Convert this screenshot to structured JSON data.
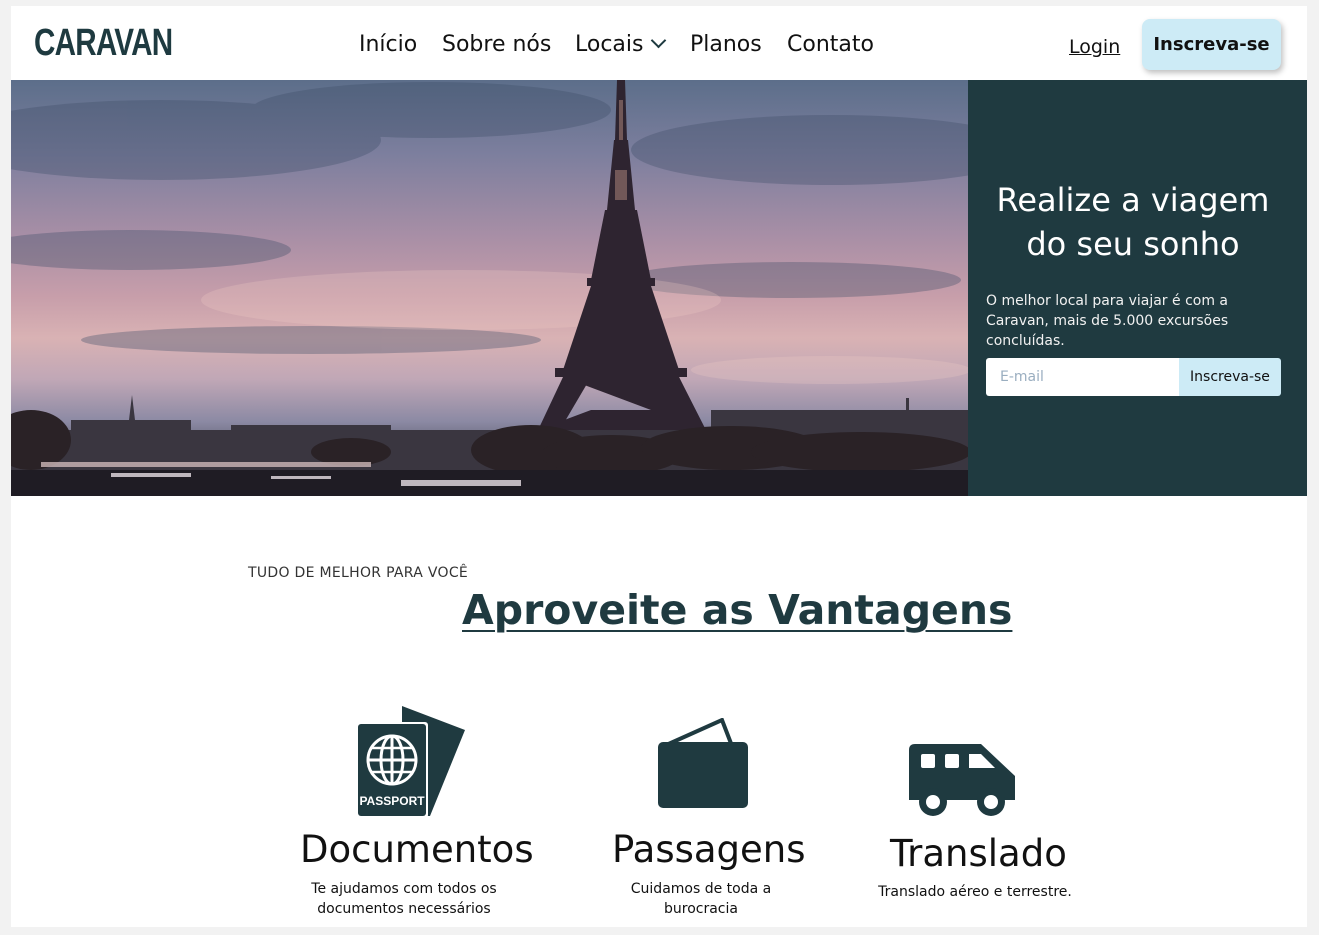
{
  "brand": {
    "logo": "CARAVAN",
    "accent": "#1f3a40",
    "cta_color": "#cdebf6"
  },
  "nav": {
    "items": [
      {
        "label": "Início"
      },
      {
        "label": "Sobre nós"
      },
      {
        "label": "Locais"
      },
      {
        "label": "Planos"
      },
      {
        "label": "Contato"
      }
    ],
    "login": "Login",
    "cta": "Inscreva-se"
  },
  "hero": {
    "title_line1": "Realize a viagem",
    "title_line2": "do seu sonho",
    "text": "O melhor local para viajar é com a Caravan, mais de 5.000 excursões concluídas.",
    "email_placeholder": "E-mail",
    "button": "Inscreva-se",
    "image": "eiffel-tower-sunset-photo"
  },
  "advantages": {
    "eyebrow": "TUDO DE MELHOR PARA VOCÊ",
    "title": "Aproveite as Vantagens",
    "items": [
      {
        "icon": "passport-icon",
        "icon_text": "PASSPORT",
        "title": "Documentos",
        "desc_line1": "Te ajudamos com todos os",
        "desc_line2": "documentos necessários"
      },
      {
        "icon": "ticket-icon",
        "title": "Passagens",
        "desc_line1": "Cuidamos de toda a",
        "desc_line2": "burocracia"
      },
      {
        "icon": "van-icon",
        "title": "Translado",
        "desc_line1": "Translado aéreo e terrestre.",
        "desc_line2": ""
      }
    ]
  }
}
